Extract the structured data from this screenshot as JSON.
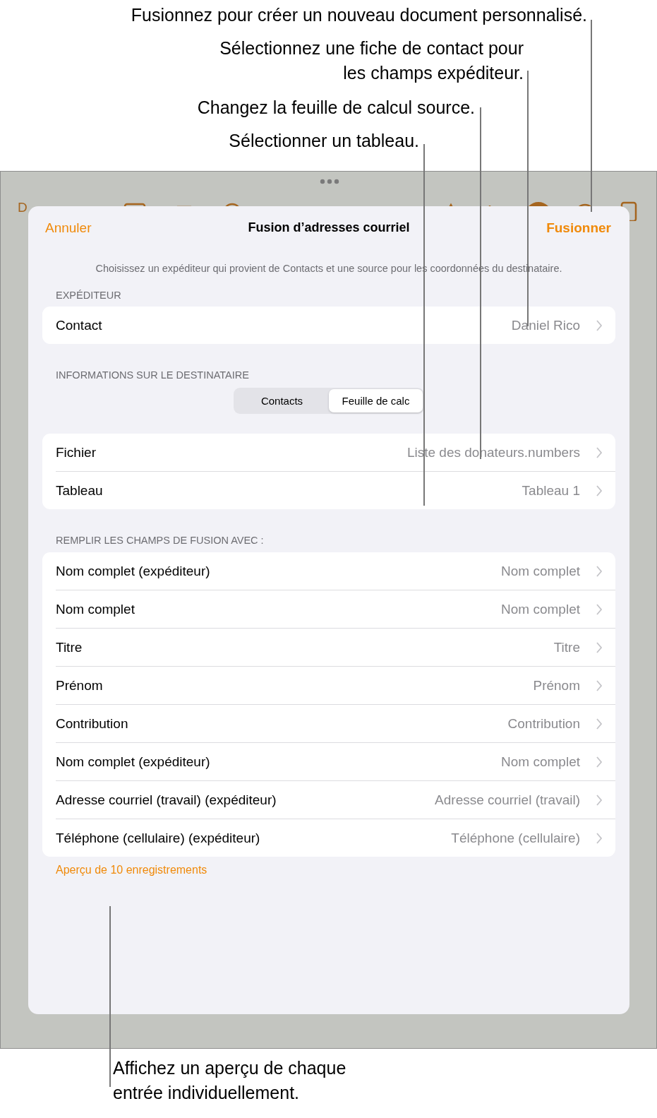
{
  "callouts_top": [
    {
      "text": "Fusionnez pour créer un nouveau document personnalisé."
    },
    {
      "text": "Sélectionnez une fiche de contact pour\nles champs expéditeur."
    },
    {
      "text": "Changez la feuille de calcul source."
    },
    {
      "text": "Sélectionner un tableau."
    }
  ],
  "toolbar": {
    "text": "D"
  },
  "sheet": {
    "cancel": "Annuler",
    "title": "Fusion d’adresses courriel",
    "confirm": "Fusionner",
    "description": "Choisissez un expéditeur qui provient de Contacts et une source pour les coordonnées du destinataire.",
    "sender_label": "EXPÉDITEUR",
    "sender_rows": [
      {
        "label": "Contact",
        "value": "Daniel Rico"
      }
    ],
    "recipient_label": "INFORMATIONS SUR LE DESTINATAIRE",
    "segments": [
      {
        "label": "Contacts",
        "selected": false
      },
      {
        "label": "Feuille de calc",
        "selected": true
      }
    ],
    "source_rows": [
      {
        "label": "Fichier",
        "value": "Liste des donateurs.numbers"
      },
      {
        "label": "Tableau",
        "value": "Tableau 1"
      }
    ],
    "fields_label": "REMPLIR LES CHAMPS DE FUSION AVEC :",
    "field_rows": [
      {
        "label": "Nom complet (expéditeur)",
        "value": "Nom complet"
      },
      {
        "label": "Nom complet",
        "value": "Nom complet"
      },
      {
        "label": "Titre",
        "value": "Titre"
      },
      {
        "label": "Prénom",
        "value": "Prénom"
      },
      {
        "label": "Contribution",
        "value": "Contribution"
      },
      {
        "label": "Nom complet (expéditeur)",
        "value": "Nom complet"
      },
      {
        "label": "Adresse courriel (travail) (expéditeur)",
        "value": "Adresse courriel (travail)"
      },
      {
        "label": "Téléphone (cellulaire) (expéditeur)",
        "value": "Téléphone (cellulaire)"
      }
    ],
    "preview_link": "Aperçu de 10 enregistrements"
  },
  "callout_bottom": {
    "text": "Affichez un aperçu de chaque\nentrée individuellement."
  }
}
